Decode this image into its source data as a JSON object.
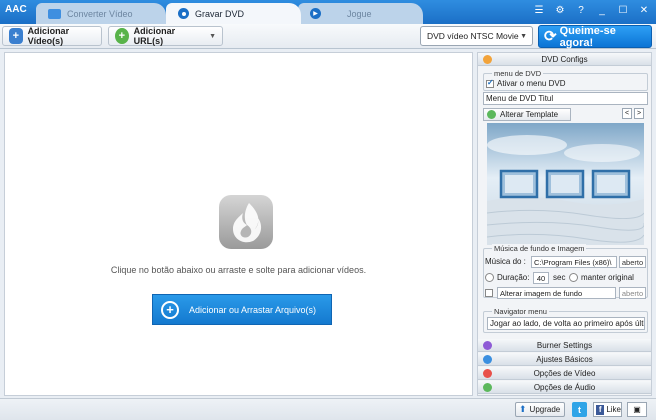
{
  "app": {
    "logo": "AAC"
  },
  "tabs": [
    {
      "label": "Converter Vídeo",
      "icon": "monitor-icon",
      "active": false
    },
    {
      "label": "Gravar DVD",
      "icon": "disc-icon",
      "active": true
    },
    {
      "label": "Jogue",
      "icon": "play-icon",
      "active": false
    }
  ],
  "toolbar": {
    "add_video": "Adicionar Vídeo(s)",
    "add_url": "Adicionar URL(s)",
    "format": "DVD vídeo NTSC Movie",
    "burn": "Queime-se agora!"
  },
  "main": {
    "hint": "Clique no botão abaixo ou arraste e solte para adicionar vídeos.",
    "drop_button": "Adicionar ou Arrastar Arquivo(s)"
  },
  "panel": {
    "dvd_configs": "DVD Configs",
    "menu_group": "menu de DVD",
    "enable_menu": "Ativar o menu DVD",
    "menu_title": "Menu de DVD Titul",
    "change_template": "Alterar Template",
    "music_group": "Música de fundo e Imagem",
    "music_label": "Música do :",
    "music_path": "C:\\Program Files (x86)\\",
    "open": "aberto",
    "duration_label": "Duração:",
    "duration_value": "40",
    "sec": "sec",
    "keep_original": "manter original",
    "change_bg": "Alterar imagem de fundo",
    "open2": "aberto",
    "navigator_group": "Navigator menu",
    "navigator_value": "Jogar ao lado, de volta ao primeiro após últim",
    "sections": [
      {
        "label": "Burner Settings",
        "color": "#8e5bd6"
      },
      {
        "label": "Ajustes Básicos",
        "color": "#3a8fe0"
      },
      {
        "label": "Opções de Vídeo",
        "color": "#e8504a"
      },
      {
        "label": "Opções de Áudio",
        "color": "#5cb85c"
      }
    ]
  },
  "status": {
    "upgrade": "Upgrade",
    "like": "Like"
  },
  "colors": {
    "accent": "#1b6fc6",
    "burn": "#0b74d5"
  }
}
